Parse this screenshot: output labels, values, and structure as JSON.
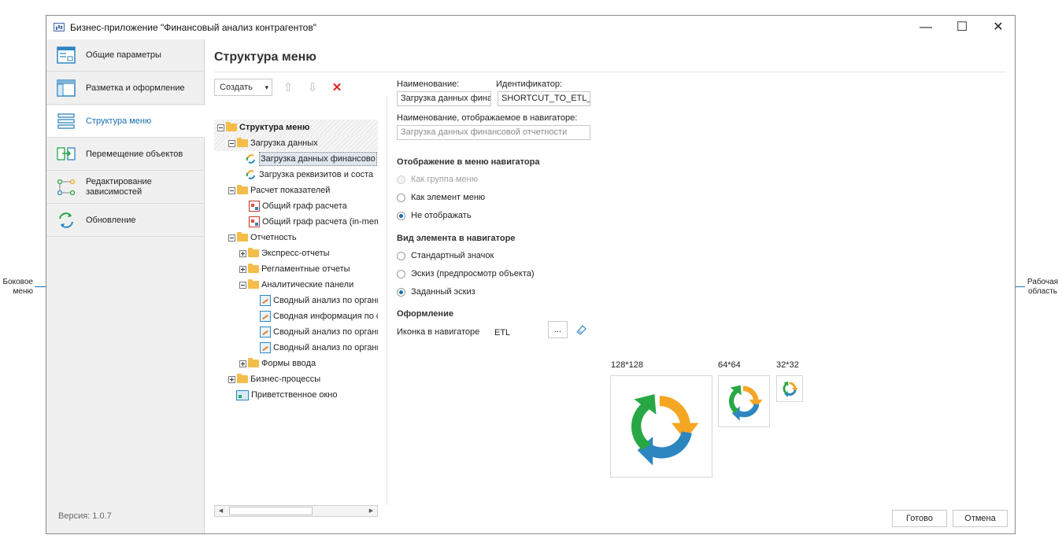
{
  "callouts": {
    "left": "Боковое меню",
    "right": "Рабочая область"
  },
  "window": {
    "title": "Бизнес-приложение \"Финансовый анализ контрагентов\"",
    "controls": {
      "minimize": "—",
      "maximize": "☐",
      "close": "✕"
    }
  },
  "sidebar": {
    "items": [
      {
        "label": "Общие параметры",
        "icon": "window-params-icon"
      },
      {
        "label": "Разметка и оформление",
        "icon": "layout-icon"
      },
      {
        "label": "Структура меню",
        "icon": "menu-structure-icon",
        "active": true
      },
      {
        "label": "Перемещение объектов",
        "icon": "move-objects-icon"
      },
      {
        "label": "Редактирование зависимостей",
        "icon": "dependencies-icon"
      },
      {
        "label": "Обновление",
        "icon": "refresh-icon"
      }
    ],
    "version": "Версия: 1.0.7"
  },
  "main": {
    "title": "Структура меню",
    "toolbar": {
      "create_label": "Создать",
      "create_arrow": "▾",
      "up_icon": "⇧",
      "down_icon": "⇩",
      "delete_icon": "✕"
    },
    "tree": [
      {
        "label": "Структура меню"
      },
      {
        "label": "Загрузка данных"
      },
      {
        "label": "Загрузка данных финансово"
      },
      {
        "label": "Загрузка реквизитов и соста"
      },
      {
        "label": "Расчет показателей"
      },
      {
        "label": "Общий граф расчета"
      },
      {
        "label": "Общий граф расчета (in-mem"
      },
      {
        "label": "Отчетность"
      },
      {
        "label": "Экспресс-отчеты"
      },
      {
        "label": "Регламентные отчеты"
      },
      {
        "label": "Аналитические панели"
      },
      {
        "label": "Сводный анализ по органи"
      },
      {
        "label": "Сводная информация по о"
      },
      {
        "label": "Сводный анализ по органи"
      },
      {
        "label": "Сводный анализ по органи"
      },
      {
        "label": "Формы ввода"
      },
      {
        "label": "Бизнес-процессы"
      },
      {
        "label": "Приветственное окно"
      }
    ],
    "scroll": {
      "left": "◀",
      "right": "▶"
    },
    "form": {
      "name_label": "Наименование:",
      "name_value": "Загрузка данных фина",
      "id_label": "Идентификатор:",
      "id_value": "SHORTCUT_TO_ETL_F",
      "nav_name_label": "Наименование, отображаемое в навигаторе:",
      "nav_name_placeholder": "Загрузка данных финансовой отчетности",
      "display_section": "Отображение в меню навигатора",
      "display_options": [
        "Как группа меню",
        "Как элемент меню",
        "Не отображать"
      ],
      "view_section": "Вид элемента в навигаторе",
      "view_options": [
        "Стандартный значок",
        "Эскиз (предпросмотр объекта)",
        "Заданный эскиз"
      ],
      "design_section": "Оформление",
      "icon_label": "Иконка в навигаторе",
      "icon_value": "ETL",
      "browse_label": "...",
      "sizes": [
        "128*128",
        "64*64",
        "32*32"
      ]
    },
    "buttons": {
      "ok": "Готово",
      "cancel": "Отмена"
    }
  },
  "colors": {
    "accent": "#1a6fb4",
    "folder": "#f4bd4a",
    "orange": "#f5a623",
    "green": "#27a844",
    "blue": "#2e86c1",
    "delete": "#e02020"
  }
}
